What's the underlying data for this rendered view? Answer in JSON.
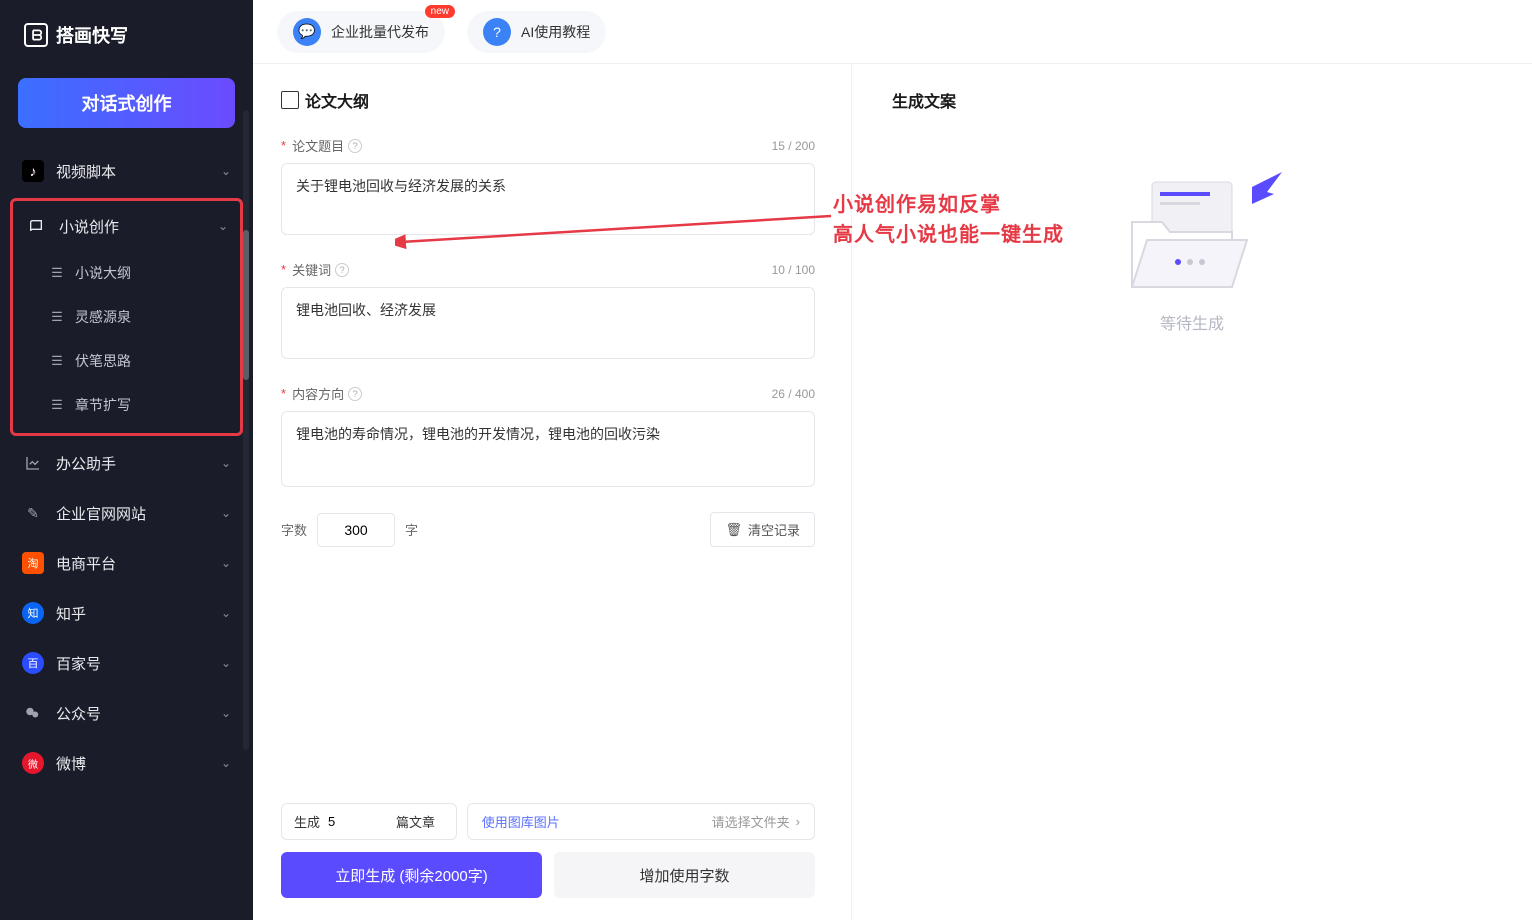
{
  "logo": {
    "text": "搭画快写"
  },
  "sidebar": {
    "create_btn": "对话式创作",
    "items": [
      {
        "key": "video-script",
        "label": "视频脚本"
      },
      {
        "key": "novel-create",
        "label": "小说创作",
        "children": [
          {
            "key": "novel-outline",
            "label": "小说大纲"
          },
          {
            "key": "inspiration",
            "label": "灵感源泉"
          },
          {
            "key": "foreshadow",
            "label": "伏笔思路"
          },
          {
            "key": "chapter-expand",
            "label": "章节扩写"
          }
        ]
      },
      {
        "key": "office",
        "label": "办公助手"
      },
      {
        "key": "website",
        "label": "企业官网网站"
      },
      {
        "key": "ecommerce",
        "label": "电商平台"
      },
      {
        "key": "zhihu",
        "label": "知乎"
      },
      {
        "key": "baijiahao",
        "label": "百家号"
      },
      {
        "key": "wechat",
        "label": "公众号"
      },
      {
        "key": "weibo",
        "label": "微博"
      }
    ]
  },
  "topbar": {
    "batch_publish": "企业批量代发布",
    "new_badge": "new",
    "ai_tutorial": "AI使用教程"
  },
  "page": {
    "title": "论文大纲",
    "fields": {
      "title": {
        "label": "论文题目",
        "value": "关于锂电池回收与经济发展的关系",
        "count": "15",
        "max": "200",
        "counter": "15 / 200"
      },
      "keywords": {
        "label": "关键词",
        "value": "锂电池回收、经济发展",
        "count": "10",
        "max": "100",
        "counter": "10 / 100"
      },
      "direction": {
        "label": "内容方向",
        "value": "锂电池的寿命情况，锂电池的开发情况，锂电池的回收污染",
        "count": "26",
        "max": "400",
        "counter": "26 / 400"
      }
    },
    "word_count": {
      "label": "字数",
      "value": "300",
      "unit": "字"
    },
    "clear_btn": "清空记录",
    "gen_row": {
      "prefix": "生成",
      "count": "5",
      "suffix": "篇文章"
    },
    "gallery": {
      "link": "使用图库图片",
      "placeholder": "请选择文件夹"
    },
    "primary_btn": "立即生成 (剩余2000字)",
    "secondary_btn": "增加使用字数"
  },
  "right": {
    "title": "生成文案",
    "placeholder": "等待生成"
  },
  "callout": {
    "line1": "小说创作易如反掌",
    "line2": "高人气小说也能一键生成"
  }
}
